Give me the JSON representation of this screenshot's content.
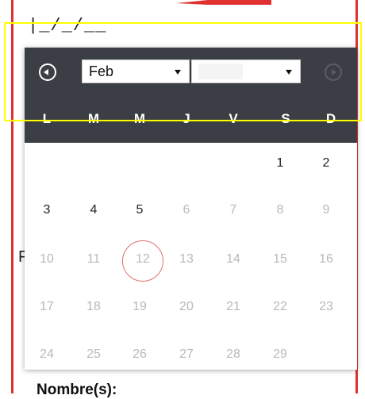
{
  "date_input": {
    "value": "|_/_/__"
  },
  "side_text": "F",
  "bottom_text": "Nombre(s):",
  "datepicker": {
    "month_select": {
      "value": "Feb"
    },
    "year_select": {
      "value": ""
    },
    "weekday_headers": [
      "L",
      "M",
      "M",
      "J",
      "V",
      "S",
      "D"
    ],
    "weeks": [
      [
        "",
        "",
        "",
        "",
        "",
        "1",
        "2"
      ],
      [
        "3",
        "4",
        "5",
        "6",
        "7",
        "8",
        "9"
      ],
      [
        "10",
        "11",
        "12",
        "13",
        "14",
        "15",
        "16"
      ],
      [
        "17",
        "18",
        "19",
        "20",
        "21",
        "22",
        "23"
      ],
      [
        "24",
        "25",
        "26",
        "27",
        "28",
        "29",
        ""
      ]
    ],
    "highlighted_day": "12"
  },
  "colors": {
    "header_bg": "#3b3e44",
    "annotation_red": "#e03131",
    "annotation_yellow": "#ffff00",
    "active_text": "#222222",
    "disabled_text": "#b9b9b9"
  },
  "icons": {
    "prev": "circle-chevron-left-icon",
    "next": "circle-chevron-right-icon"
  }
}
